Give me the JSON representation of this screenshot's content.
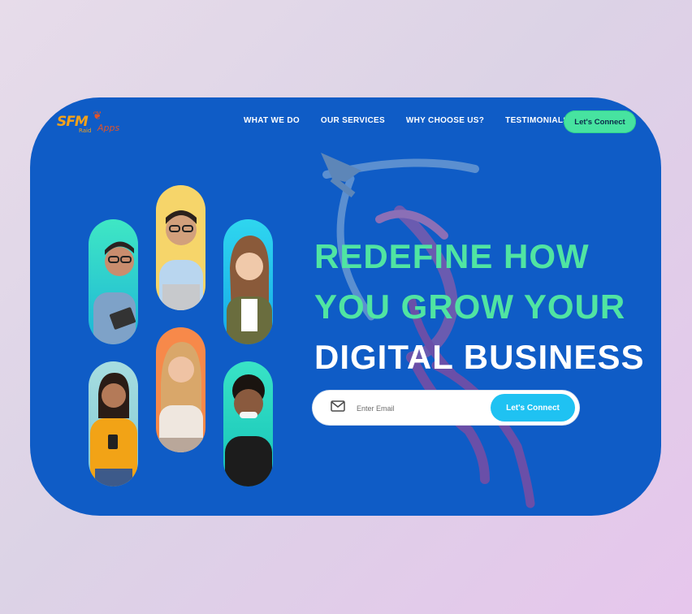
{
  "brand": {
    "logo_main": "SFM",
    "logo_sub": "Raid",
    "logo_apps": "Apps"
  },
  "nav": {
    "items": [
      {
        "label": "WHAT WE DO"
      },
      {
        "label": "OUR SERVICES"
      },
      {
        "label": "WHY CHOOSE US?"
      },
      {
        "label": "TESTIMONIALS"
      }
    ],
    "cta_label": "Let's Connect"
  },
  "hero": {
    "line1": "REDEFINE HOW",
    "line2": "YOU GROW YOUR",
    "line3": "DIGITAL BUSINESS"
  },
  "signup": {
    "email_placeholder": "Enter Email",
    "submit_label": "Let's Connect"
  },
  "colors": {
    "card_bg": "#0f5cc6",
    "accent_green": "#47e3a0",
    "accent_cyan": "#1fc2f2",
    "logo_orange": "#f3a21a"
  },
  "icons": {
    "mail": "envelope-icon",
    "decor": "arrow-figure-illustration"
  },
  "people": [
    {
      "name": "person-man-glasses-laptop"
    },
    {
      "name": "person-man-glasses-smiling"
    },
    {
      "name": "person-woman-long-hair"
    },
    {
      "name": "person-woman-phone"
    },
    {
      "name": "person-woman-blonde"
    },
    {
      "name": "person-man-curly-hair"
    }
  ]
}
